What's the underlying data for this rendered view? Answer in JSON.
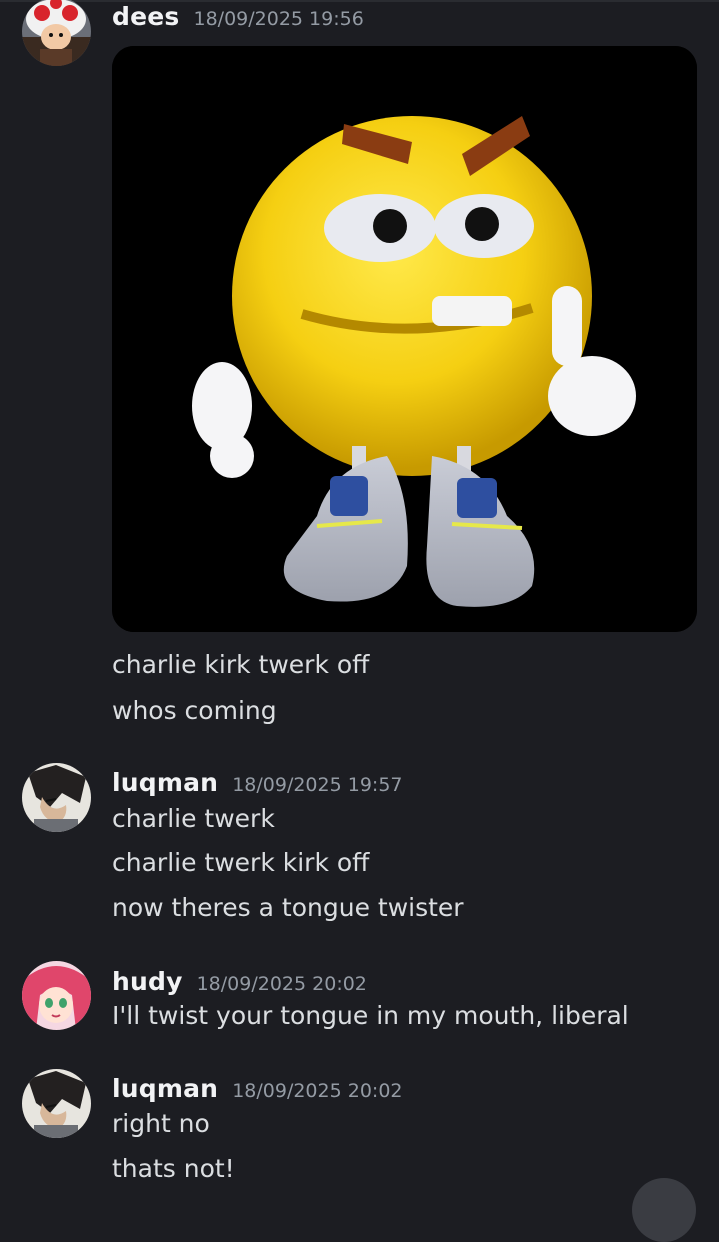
{
  "messages": [
    {
      "author": "dees",
      "timestamp": "18/09/2025 19:56",
      "avatar": "toad-avatar",
      "attachment": "angry-emoji-image",
      "lines": [
        "charlie kirk twerk off",
        "whos coming"
      ]
    },
    {
      "author": "luqman",
      "timestamp": "18/09/2025 19:57",
      "avatar": "anime-dark-hair-avatar",
      "lines": [
        "charlie twerk",
        "charlie twerk kirk off",
        "now theres a tongue twister"
      ]
    },
    {
      "author": "hudy",
      "timestamp": "18/09/2025 20:02",
      "avatar": "anime-pink-hair-avatar",
      "lines": [
        "I'll twist your tongue in my mouth, liberal"
      ]
    },
    {
      "author": "luqman",
      "timestamp": "18/09/2025 20:02",
      "avatar": "anime-dark-hair-avatar",
      "lines": [
        "right no",
        "thats not!"
      ]
    }
  ],
  "colors": {
    "background": "#1c1d22",
    "username": "#f2f3f5",
    "timestamp": "#949ba4",
    "text": "#dbdee1"
  }
}
